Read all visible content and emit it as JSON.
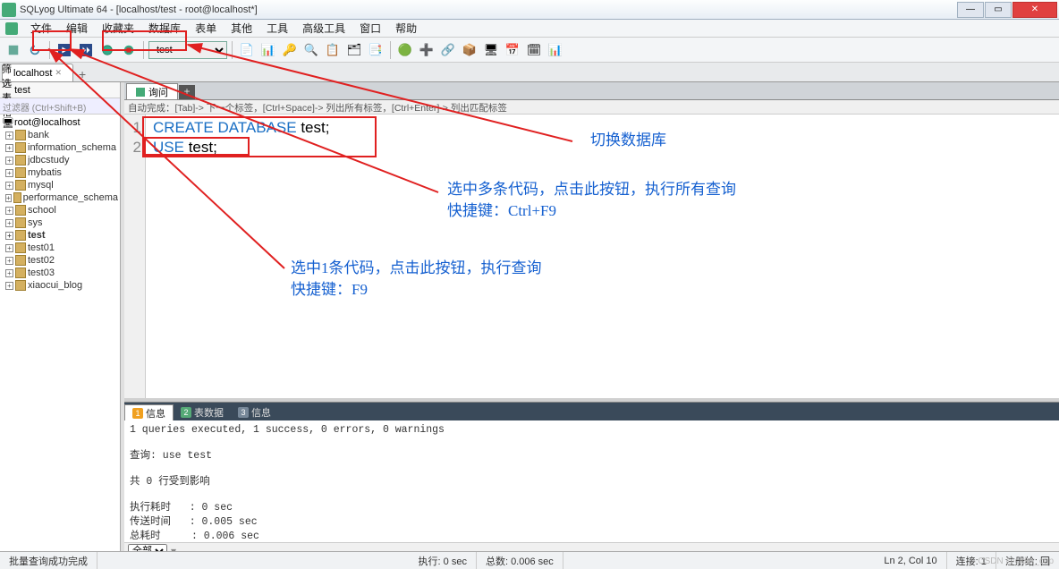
{
  "title": "SQLyog Ultimate 64 - [localhost/test - root@localhost*]",
  "menu": [
    "文件",
    "编辑",
    "收藏夹",
    "数据库",
    "表单",
    "其他",
    "工具",
    "高级工具",
    "窗口",
    "帮助"
  ],
  "db_selected": "test",
  "conn_tab": "localhost",
  "sidebar": {
    "filter_label": "筛选表格",
    "filter_value": "test",
    "placeholder": "过滤器 (Ctrl+Shift+B)",
    "root": "root@localhost",
    "dbs": [
      "bank",
      "information_schema",
      "jdbcstudy",
      "mybatis",
      "mysql",
      "performance_schema",
      "school",
      "sys",
      "test",
      "test01",
      "test02",
      "test03",
      "xiaocui_blog"
    ],
    "bold_db": "test"
  },
  "editor": {
    "tab": "询问",
    "hint": "自动完成：[Tab]-> 下一个标签，[Ctrl+Space]-> 列出所有标签，[Ctrl+Enter]-> 列出匹配标签",
    "lines": [
      {
        "n": "1",
        "tokens": [
          {
            "t": "CREATE",
            "c": "kw"
          },
          {
            "t": " "
          },
          {
            "t": "DATABASE",
            "c": "kw"
          },
          {
            "t": " test;"
          }
        ]
      },
      {
        "n": "2",
        "tokens": [
          {
            "t": "USE",
            "c": "kw"
          },
          {
            "t": " test;"
          }
        ]
      }
    ]
  },
  "result": {
    "tabs": [
      {
        "n": "1",
        "label": "信息"
      },
      {
        "n": "2",
        "label": "表数据"
      },
      {
        "n": "3",
        "label": "信息"
      }
    ],
    "body": "1 queries executed, 1 success, 0 errors, 0 warnings\n\n查询: use test\n\n共 0 行受到影响\n\n执行耗时   : 0 sec\n传送时间   : 0.005 sec\n总耗时     : 0.006 sec",
    "footer_sel": "全部"
  },
  "status": {
    "left": "批量查询成功完成",
    "exec": "执行: 0 sec",
    "total": "总数: 0.006 sec",
    "ln": "Ln 2, Col 10",
    "conn": "连接: 1",
    "right": "注册给: 回"
  },
  "annotations": {
    "a1": "切换数据库",
    "a2_l1": "选中多条代码，点击此按钮，执行所有查询",
    "a2_l2": "快捷键：Ctrl+F9",
    "a3_l1": "选中1条代码，点击此按钮，执行查询",
    "a3_l2": "快捷键：F9"
  },
  "watermark": "CSDN @cider_cup"
}
